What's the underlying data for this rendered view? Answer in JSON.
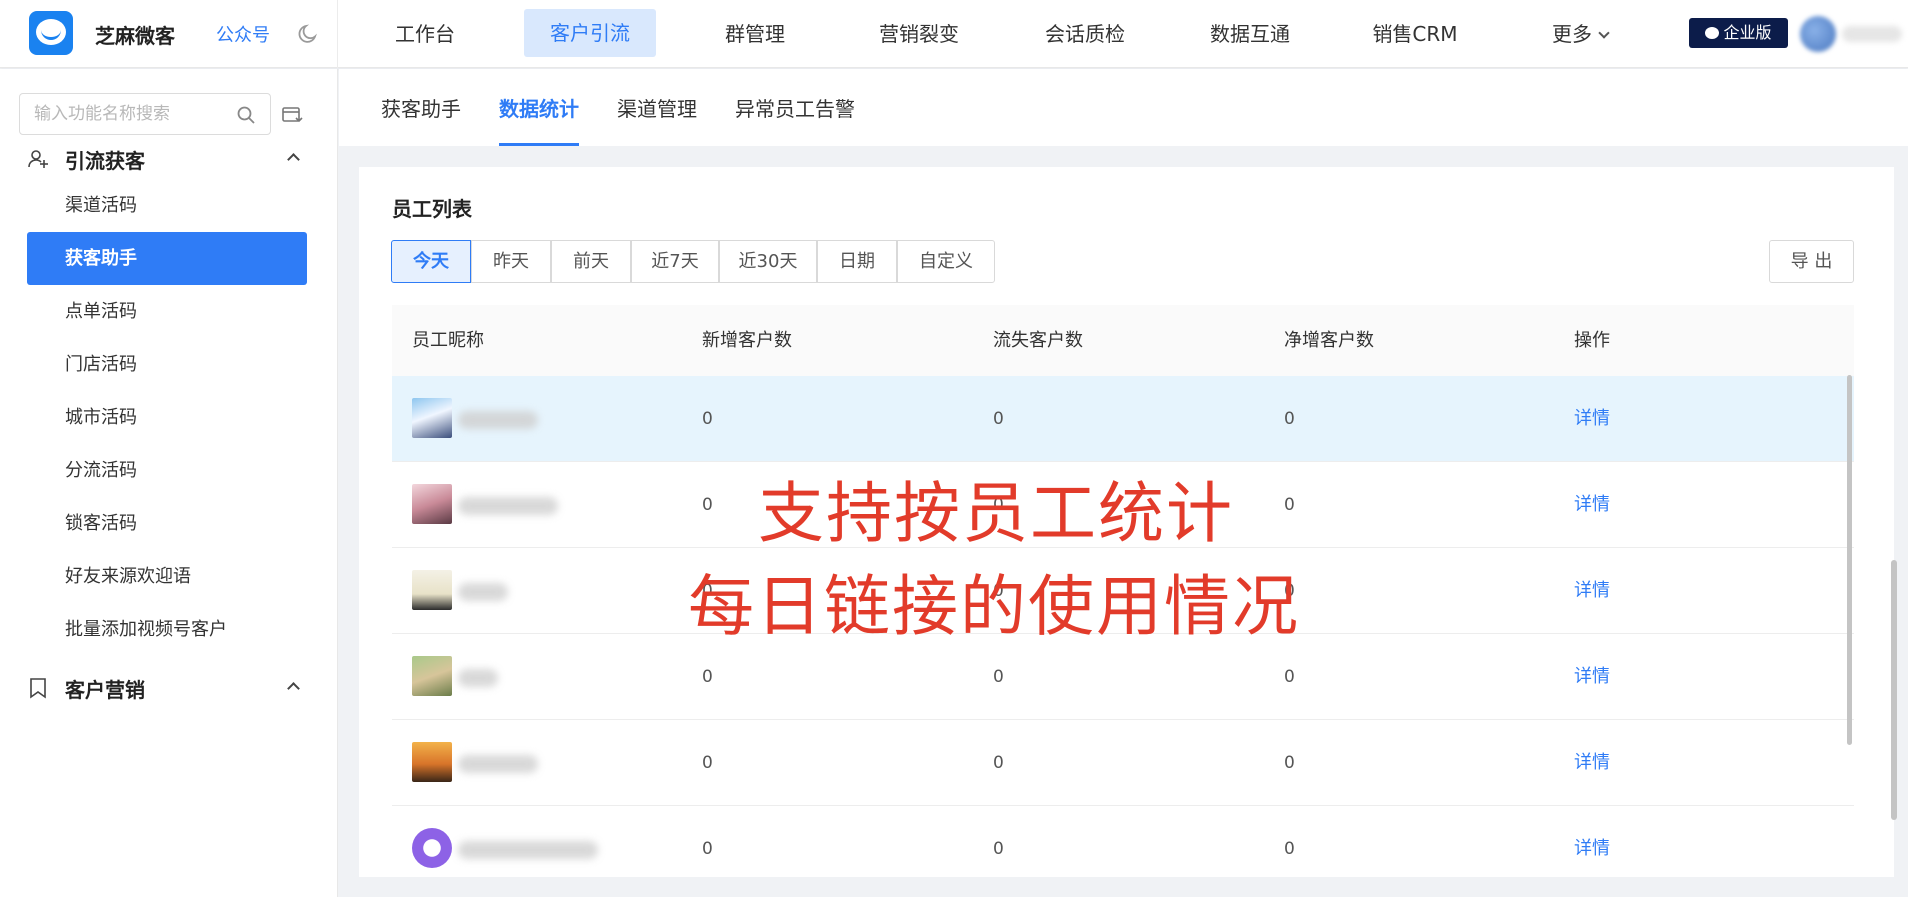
{
  "header": {
    "brand": "芝麻微客",
    "account_link": "公众号",
    "nav": [
      "工作台",
      "客户引流",
      "群管理",
      "营销裂变",
      "会话质检",
      "数据互通",
      "销售CRM",
      "更多"
    ],
    "active_nav": "客户引流",
    "edition_badge": "企业版"
  },
  "sidebar": {
    "search_placeholder": "输入功能名称搜索",
    "groups": [
      {
        "label": "引流获客",
        "items": [
          "渠道活码",
          "获客助手",
          "点单活码",
          "门店活码",
          "城市活码",
          "分流活码",
          "锁客活码",
          "好友来源欢迎语",
          "批量添加视频号客户"
        ]
      },
      {
        "label": "客户营销"
      }
    ],
    "active_item": "获客助手"
  },
  "subtabs": [
    "获客助手",
    "数据统计",
    "渠道管理",
    "异常员工告警"
  ],
  "active_subtab": "数据统计",
  "card": {
    "title": "员工列表",
    "date_filters": [
      "今天",
      "昨天",
      "前天",
      "近7天",
      "近30天",
      "日期",
      "自定义"
    ],
    "active_filter": "今天",
    "export_label": "导 出",
    "columns": [
      "员工昵称",
      "新增客户数",
      "流失客户数",
      "净增客户数",
      "操作"
    ],
    "rows": [
      {
        "new": "0",
        "lost": "0",
        "net": "0",
        "action": "详情"
      },
      {
        "new": "0",
        "lost": "0",
        "net": "0",
        "action": "详情"
      },
      {
        "new": "0",
        "lost": "0",
        "net": "0",
        "action": "详情"
      },
      {
        "new": "0",
        "lost": "0",
        "net": "0",
        "action": "详情"
      },
      {
        "new": "0",
        "lost": "0",
        "net": "0",
        "action": "详情"
      },
      {
        "new": "0",
        "lost": "0",
        "net": "0",
        "action": "详情"
      }
    ]
  },
  "overlay": {
    "line1": "支持按员工统计",
    "line2": "每日链接的使用情况"
  },
  "colors": {
    "accent": "#2f7cf6",
    "overlay_red": "#e23b2a",
    "badge_bg": "#0c1c4a"
  }
}
